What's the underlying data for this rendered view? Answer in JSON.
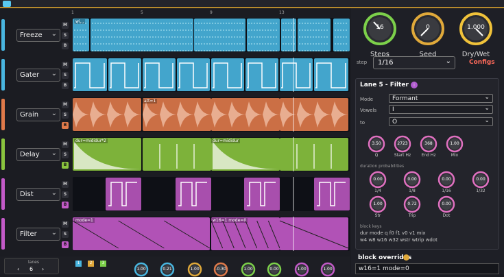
{
  "ruler": [
    "1",
    "5",
    "9",
    "13"
  ],
  "lanes": [
    {
      "name": "Freeze",
      "color": "#49b6e0",
      "blocks": [
        "wi..."
      ]
    },
    {
      "name": "Gater",
      "color": "#49b6e0",
      "blocks": []
    },
    {
      "name": "Grain",
      "color": "#e07a4a",
      "blocks": [
        "att=1"
      ]
    },
    {
      "name": "Delay",
      "color": "#8ac43e",
      "blocks": [
        "dur=mididur*2",
        "dur=mididur"
      ]
    },
    {
      "name": "Dist",
      "color": "#c35ac8",
      "blocks": []
    },
    {
      "name": "Filter",
      "color": "#c35ac8",
      "blocks": [
        "mode=1",
        "w16=1 mode=0"
      ]
    }
  ],
  "mode_buttons": [
    "M",
    "S",
    "B"
  ],
  "knobs_top": [
    {
      "value": "16",
      "label": "Steps",
      "color": "#7cd04a"
    },
    {
      "value": "0",
      "label": "Seed",
      "color": "#e0a93a"
    },
    {
      "value": "1.000",
      "label": "Dry/Wet",
      "color": "#f0c23a"
    }
  ],
  "step": {
    "label": "step",
    "value": "1/16",
    "configs": "Configs"
  },
  "panel": {
    "title": "Lane 5  -  Filter",
    "mode_label": "Mode",
    "mode_value": "Formant",
    "vowels_label": "Vowels",
    "vowels_value": "I",
    "to_label": "to",
    "to_value": "O",
    "knobs": [
      {
        "value": "3.50",
        "label": "Q"
      },
      {
        "value": "2723",
        "label": "Start Hz"
      },
      {
        "value": "368",
        "label": "End Hz"
      },
      {
        "value": "1.00",
        "label": "Mix"
      }
    ],
    "dur_title": "duration probabilities",
    "dur_knobs": [
      {
        "value": "0.00",
        "label": "1/4"
      },
      {
        "value": "0.00",
        "label": "1/8"
      },
      {
        "value": "0.00",
        "label": "1/16"
      },
      {
        "value": "0.00",
        "label": "1/32"
      },
      {
        "value": "1.00",
        "label": "Str"
      },
      {
        "value": "0.72",
        "label": "Trip"
      },
      {
        "value": "0.00",
        "label": "Dot"
      }
    ],
    "keys_title": "block keys",
    "keys_line1": "dur mode q f0 f1 v0 v1 mix",
    "keys_line2": "w4 w8 w16 w32 wstr wtrip wdot"
  },
  "overrides": {
    "title": "block overrides",
    "value": "w16=1 mode=0"
  },
  "bottom": {
    "lanes_label": "lanes",
    "lanes_value": "6",
    "tags": [
      "1",
      "2",
      "3"
    ],
    "knobs": [
      "1.00",
      "0.21",
      "1.00",
      "-0.30",
      "1.00",
      "0.00",
      "1.00",
      "1.00"
    ]
  },
  "colors": {
    "accent": "#f0c23a",
    "configs": "#ff6a5a"
  }
}
